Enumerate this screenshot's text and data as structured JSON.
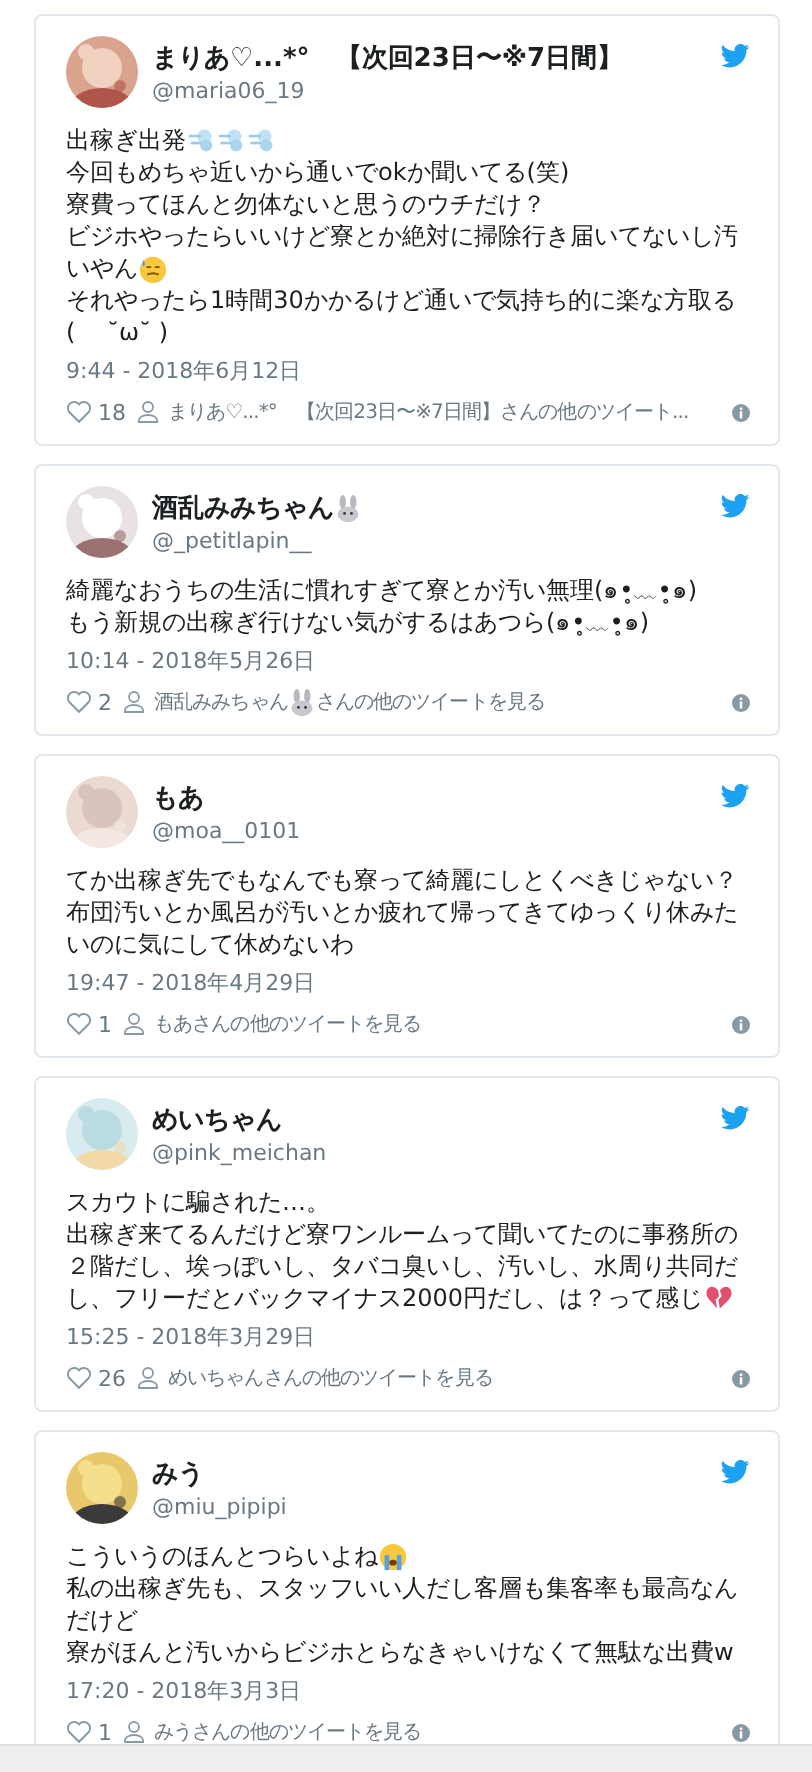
{
  "tweets": [
    {
      "avatar": {
        "kind": "picture"
      },
      "name": [
        {
          "kind": "text",
          "text": "まりあ♡...*°　【次回23日〜※7日間】"
        }
      ],
      "handle": "@maria06_19",
      "body": [
        [
          {
            "kind": "text",
            "text": "出稼ぎ出発"
          },
          {
            "kind": "dash"
          },
          {
            "kind": "dash"
          },
          {
            "kind": "dash"
          }
        ],
        [
          {
            "kind": "text",
            "text": "今回もめちゃ近いから通いでokか聞いてる(笑)"
          }
        ],
        [
          {
            "kind": "text",
            "text": "寮費ってほんと勿体ないと思うのウチだけ？"
          }
        ],
        [
          {
            "kind": "text",
            "text": "ビジホやったらいいけど寮とか絶対に掃除行き届いてないし汚"
          }
        ],
        [
          {
            "kind": "text",
            "text": "いやん"
          },
          {
            "kind": "sweat"
          }
        ],
        [
          {
            "kind": "text",
            "text": "それやったら1時間30かかるけど通いで気持ち的に楽な方取る"
          }
        ],
        [
          {
            "kind": "text",
            "text": "(　 ˘ω˘ )"
          }
        ]
      ],
      "time": "9:44 - 2018年6月12日",
      "likes": "18",
      "more": [
        {
          "kind": "text",
          "text": "まりあ♡...*°　【次回23日〜※7日間】さんの他のツイート..."
        }
      ]
    },
    {
      "avatar": {
        "kind": "picture"
      },
      "name": [
        {
          "kind": "text",
          "text": "酒乱みみちゃん"
        },
        {
          "kind": "rabbit"
        }
      ],
      "handle": "@_petitlapin__",
      "body": [
        [
          {
            "kind": "text",
            "text": "綺麗なおうちの生活に慣れすぎて寮とか汚い無理(๑•̥﹏•̥๑)"
          }
        ],
        [
          {
            "kind": "text",
            "text": "もう新規の出稼ぎ行けない気がするはあつら(๑•̥﹏•̥๑)"
          }
        ]
      ],
      "time": "10:14 - 2018年5月26日",
      "likes": "2",
      "more": [
        {
          "kind": "text",
          "text": "酒乱みみちゃん"
        },
        {
          "kind": "rabbit"
        },
        {
          "kind": "text",
          "text": "さんの他のツイートを見る"
        }
      ]
    },
    {
      "avatar": {
        "kind": "picture"
      },
      "name": [
        {
          "kind": "text",
          "text": "もあ"
        }
      ],
      "handle": "@moa__0101",
      "body": [
        [
          {
            "kind": "text",
            "text": "てか出稼ぎ先でもなんでも寮って綺麗にしとくべきじゃない？"
          }
        ],
        [
          {
            "kind": "text",
            "text": "布団汚いとか風呂が汚いとか疲れて帰ってきてゆっくり休みた"
          }
        ],
        [
          {
            "kind": "text",
            "text": "いのに気にして休めないわ"
          }
        ]
      ],
      "time": "19:47 - 2018年4月29日",
      "likes": "1",
      "more": [
        {
          "kind": "text",
          "text": "もあさんの他のツイートを見る"
        }
      ]
    },
    {
      "avatar": {
        "kind": "picture"
      },
      "name": [
        {
          "kind": "text",
          "text": "めいちゃん"
        }
      ],
      "handle": "@pink_meichan",
      "body": [
        [
          {
            "kind": "text",
            "text": "スカウトに騙された…。"
          }
        ],
        [
          {
            "kind": "text",
            "text": "出稼ぎ来てるんだけど寮ワンルームって聞いてたのに事務所の"
          }
        ],
        [
          {
            "kind": "text",
            "text": "２階だし、埃っぽいし、タバコ臭いし、汚いし、水周り共同だ"
          }
        ],
        [
          {
            "kind": "text",
            "text": "し、フリーだとバックマイナス2000円だし、は？って感じ"
          },
          {
            "kind": "broken-heart"
          }
        ]
      ],
      "time": "15:25 - 2018年3月29日",
      "likes": "26",
      "more": [
        {
          "kind": "text",
          "text": "めいちゃんさんの他のツイートを見る"
        }
      ]
    },
    {
      "avatar": {
        "kind": "picture"
      },
      "name": [
        {
          "kind": "text",
          "text": "みう"
        }
      ],
      "handle": "@miu_pipipi",
      "body": [
        [
          {
            "kind": "text",
            "text": "こういうのほんとつらいよね"
          },
          {
            "kind": "crying"
          }
        ],
        [
          {
            "kind": "text",
            "text": "私の出稼ぎ先も、スタッフいい人だし客層も集客率も最高なん"
          }
        ],
        [
          {
            "kind": "text",
            "text": "だけど"
          }
        ],
        [
          {
            "kind": "text",
            "text": "寮がほんと汚いからビジホとらなきゃいけなくて無駄な出費w"
          }
        ]
      ],
      "time": "17:20 - 2018年3月3日",
      "likes": "1",
      "more": [
        {
          "kind": "text",
          "text": "みうさんの他のツイートを見る"
        }
      ]
    }
  ]
}
